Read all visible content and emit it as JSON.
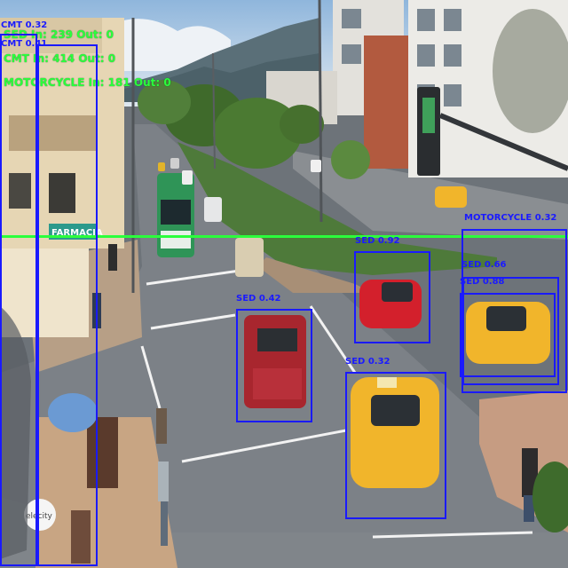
{
  "overlay": {
    "colors": {
      "box": "#1a1aff",
      "counter_text": "#2bff3c",
      "count_line": "#2bff3c"
    },
    "counters": [
      {
        "text": "SED In: 239 Out: 0"
      },
      {
        "text": "CMT In: 414 Out: 0"
      },
      {
        "text": "MOTORCYCLE In: 181 Out: 0"
      }
    ],
    "detections": [
      {
        "label": "CMT 0.32"
      },
      {
        "label": "CMT 0.41"
      },
      {
        "label": "SED 0.42"
      },
      {
        "label": "SED 0.92"
      },
      {
        "label": "SED 0.32"
      },
      {
        "label": "MOTORCYCLE 0.32"
      },
      {
        "label": "SED 0.66"
      },
      {
        "label": "SED 0.88"
      }
    ]
  },
  "scene": {
    "signage": {
      "shop_sign": "FARMACIA",
      "umbrella_text": "elecity"
    }
  }
}
